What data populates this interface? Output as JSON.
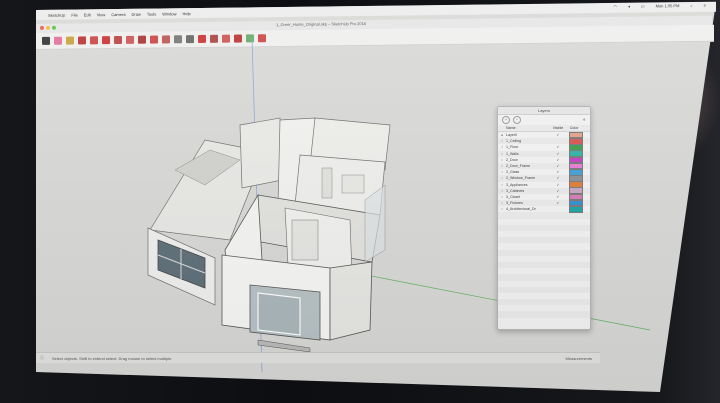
{
  "menubar": {
    "app_name": "SketchUp",
    "items": [
      "File",
      "Edit",
      "View",
      "Camera",
      "Draw",
      "Tools",
      "Window",
      "Help"
    ],
    "clock": "Mon 1:05 PM"
  },
  "window": {
    "title": "1_Greer_Home_Original.skp – SketchUp Pro 2016"
  },
  "layers_panel": {
    "title": "Layers",
    "columns": {
      "name": "Name",
      "visible": "Visible",
      "color": "Color"
    },
    "layers": [
      {
        "name": "Layer0",
        "visible": "✓",
        "color": "#e8a08c"
      },
      {
        "name": "1_Ceiling",
        "visible": "",
        "color": "#d9534f"
      },
      {
        "name": "1_Floor",
        "visible": "✓",
        "color": "#3a9d4f"
      },
      {
        "name": "1_Walls",
        "visible": "✓",
        "color": "#2bb3a6"
      },
      {
        "name": "2_Door",
        "visible": "✓",
        "color": "#c23bc9"
      },
      {
        "name": "2_Door_Frame",
        "visible": "✓",
        "color": "#e87ad6"
      },
      {
        "name": "2_Glass",
        "visible": "✓",
        "color": "#3f9fd6"
      },
      {
        "name": "2_Window_Frame",
        "visible": "✓",
        "color": "#8a8f96"
      },
      {
        "name": "3_Appliances",
        "visible": "✓",
        "color": "#e07c36"
      },
      {
        "name": "3_Cabinets",
        "visible": "✓",
        "color": "#c7a6c2"
      },
      {
        "name": "3_Closet",
        "visible": "✓",
        "color": "#d77bb8"
      },
      {
        "name": "3_Fixtures",
        "visible": "✓",
        "color": "#2f8fcf"
      },
      {
        "name": "4_Architectural_Dr",
        "visible": "",
        "color": "#1aa3a0"
      }
    ],
    "empty_rows": 18
  },
  "statusbar": {
    "left": "Select objects. Shift to extend select. Drag mouse to select multiple.",
    "right": "Measurements"
  },
  "toolbar_icons": [
    "select-icon",
    "eraser-icon",
    "paint-icon",
    "line-icon",
    "arc-icon",
    "rectangle-icon",
    "pushpull-icon",
    "move-icon",
    "rotate-icon",
    "scale-icon",
    "offset-icon",
    "tape-icon",
    "text-icon",
    "orbit-icon",
    "pan-icon",
    "zoom-icon",
    "zoom-extents-icon",
    "warehouse-icon",
    "extension-icon"
  ]
}
